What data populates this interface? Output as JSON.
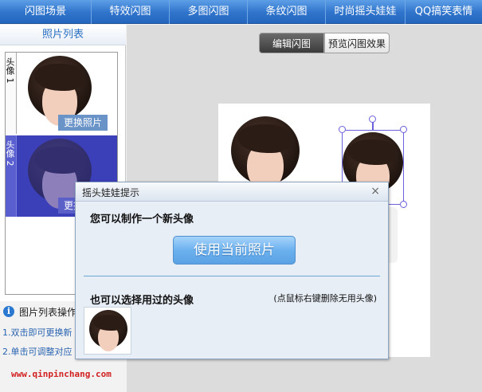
{
  "top_tabs": [
    "闪图场景",
    "特效闪图",
    "多图闪图",
    "条纹闪图",
    "时尚摇头娃娃",
    "QQ搞笑表情"
  ],
  "left_panel": {
    "title": "照片列表",
    "items": [
      {
        "label": "头像 1",
        "button": "更换照片"
      },
      {
        "label": "头像 2",
        "button": "更换照片"
      }
    ],
    "info_title": "图片列表操作",
    "info_lines": [
      "1.双击即可更换新",
      "2.单击可调整对应"
    ]
  },
  "mode_toggle": {
    "active": "编辑闪图",
    "inactive": "预览闪图效果"
  },
  "dialog": {
    "title": "摇头娃娃提示",
    "close": "×",
    "new_heading": "您可以制作一个新头像",
    "use_button": "使用当前照片",
    "used_heading": "也可以选择用过的头像",
    "hint": "(点鼠标右键删除无用头像)"
  },
  "watermark": "www.qinpinchang.com",
  "colors": {
    "tab_bar": "#2f74cc",
    "selection": "#6a62dd",
    "button": "#6cb1ee"
  }
}
